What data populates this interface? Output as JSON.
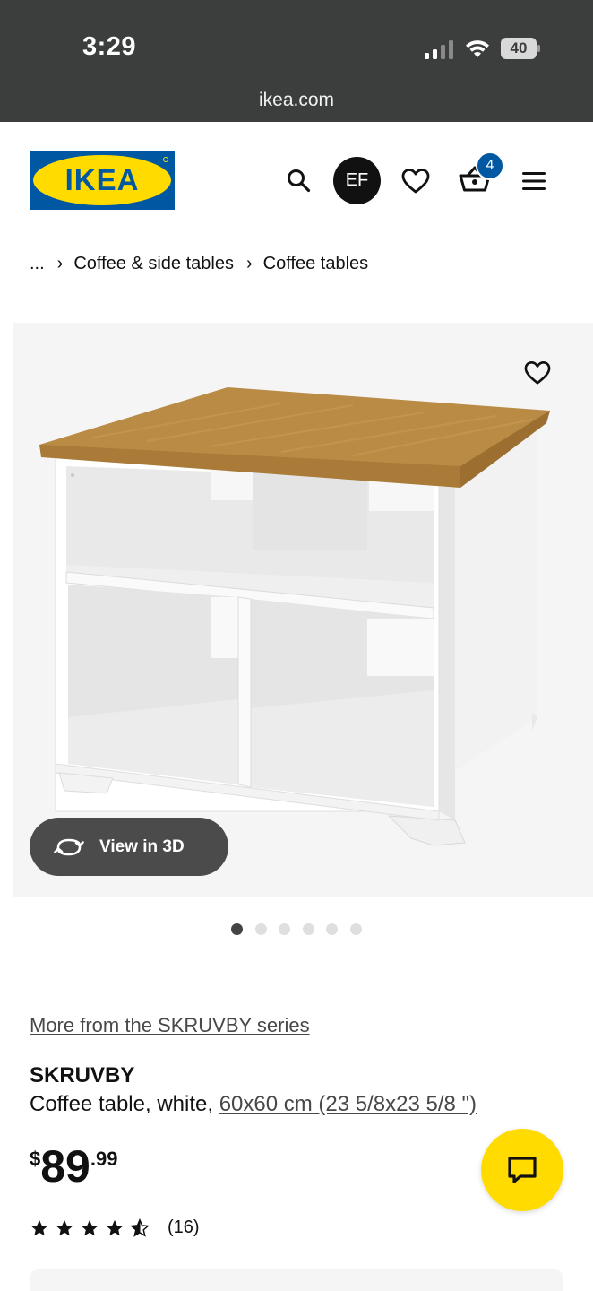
{
  "status_bar": {
    "time": "3:29",
    "battery": "40",
    "url": "ikea.com"
  },
  "header": {
    "logo_text": "IKEA",
    "account_initials": "EF",
    "cart_count": "4",
    "brand_blue": "#0058a3",
    "brand_yellow": "#ffdb00"
  },
  "breadcrumb": {
    "items": [
      "...",
      "Coffee & side tables",
      "Coffee tables"
    ]
  },
  "gallery": {
    "view_3d_label": "View in 3D",
    "image_count": 6,
    "active_index": 0
  },
  "product": {
    "series_link": "More from the SKRUVBY series",
    "name": "SKRUVBY",
    "description": "Coffee table, white, ",
    "size_link": "60x60 cm (23 5/8x23 5/8 \")",
    "price_currency": "$",
    "price_int": "89",
    "price_dec": ".99",
    "rating": 4.5,
    "review_count": "(16)"
  }
}
